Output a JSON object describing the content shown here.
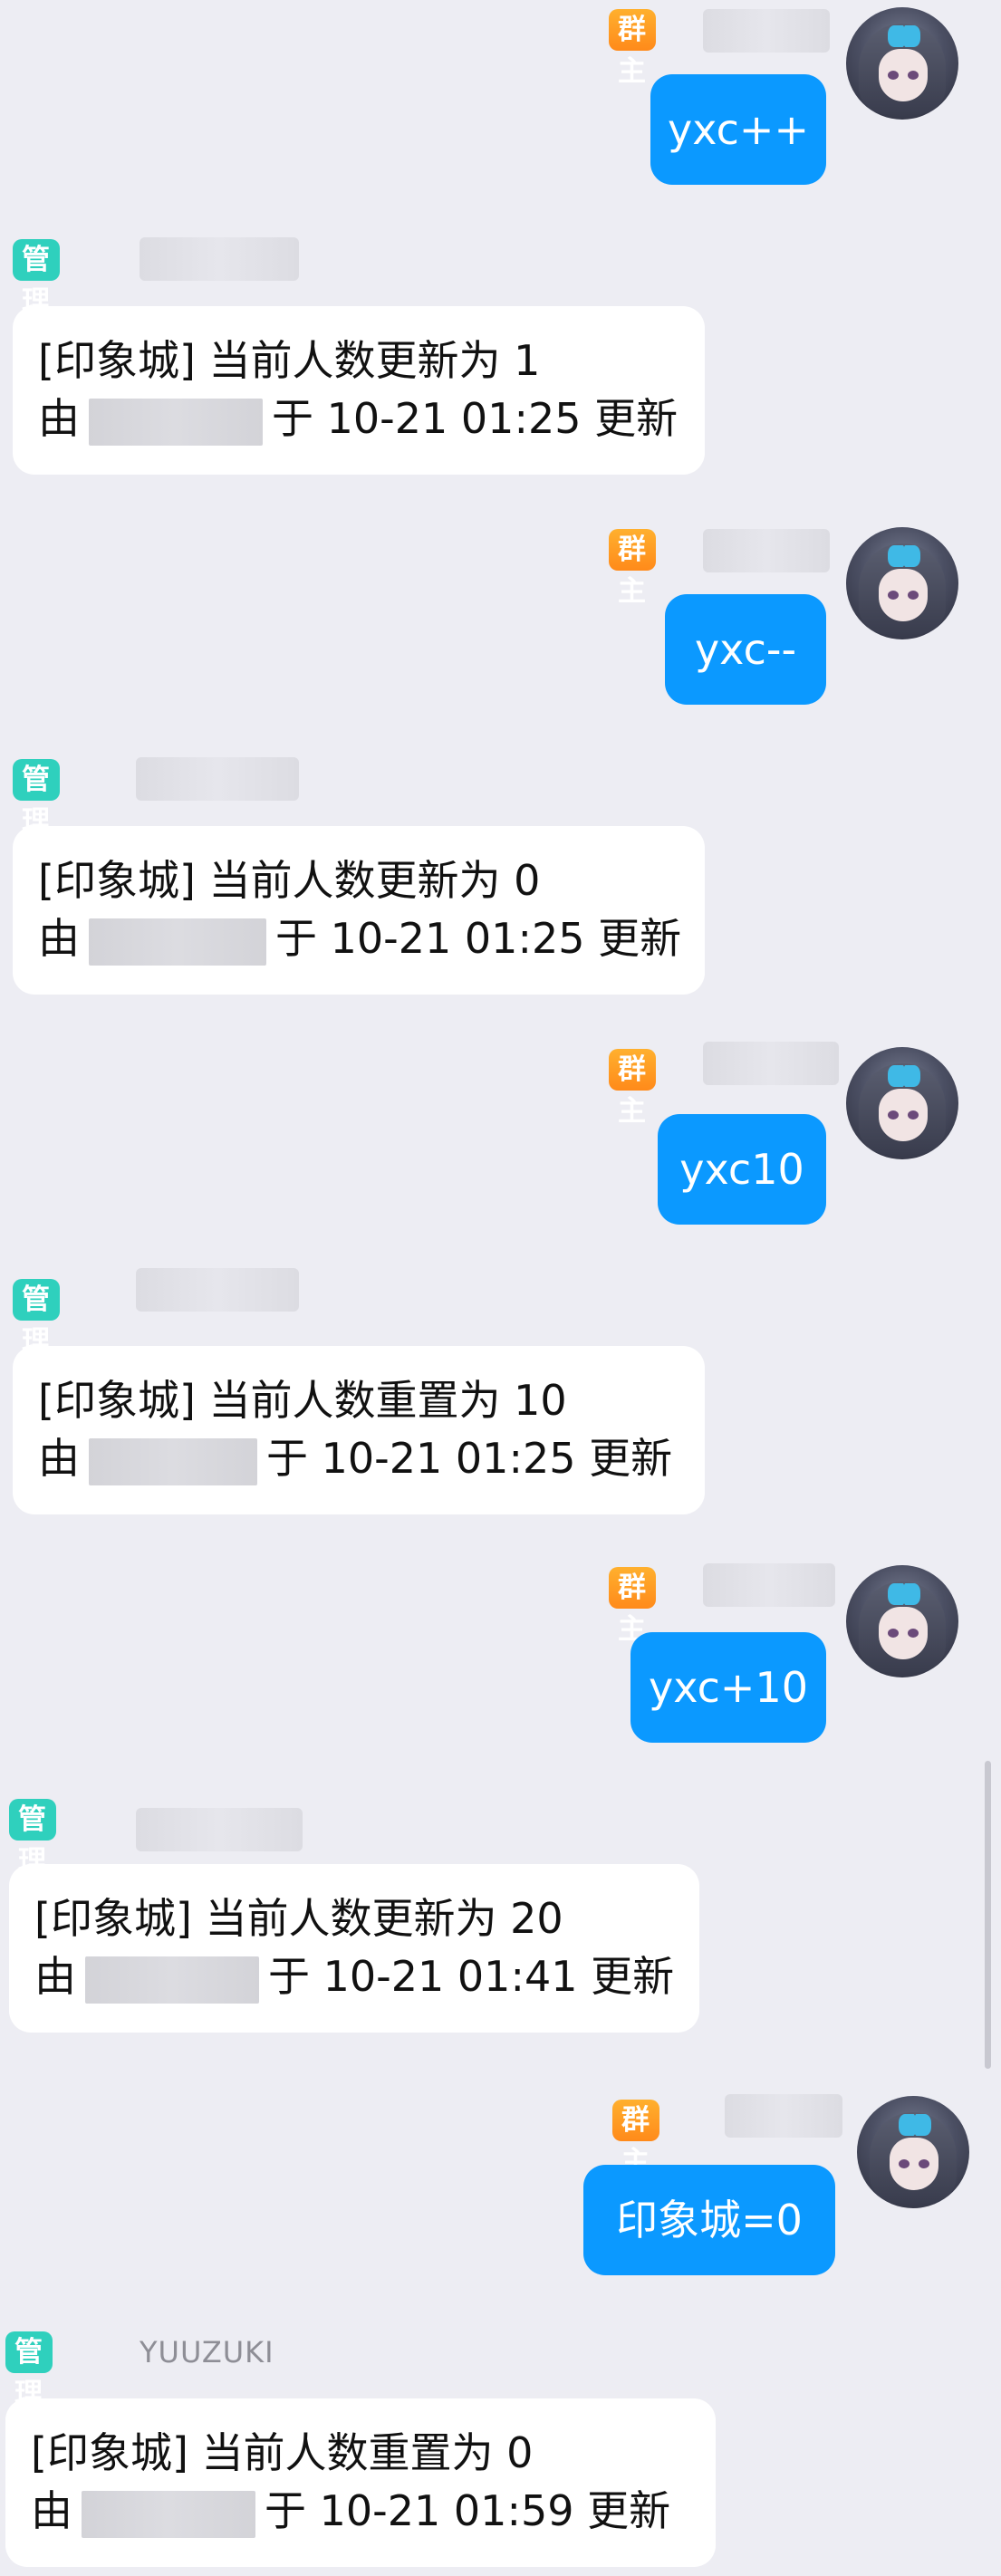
{
  "badges": {
    "owner": "群主",
    "admin": "管理员"
  },
  "conversation": [
    {
      "role": "owner",
      "text": "yxc++"
    },
    {
      "role": "admin",
      "line1": "[印象城] 当前人数更新为 1",
      "prefix": "由",
      "suffix": "于 10-21 01:25 更新"
    },
    {
      "role": "owner",
      "text": "yxc--"
    },
    {
      "role": "admin",
      "line1": "[印象城] 当前人数更新为 0",
      "prefix": "由",
      "suffix": "于 10-21 01:25 更新"
    },
    {
      "role": "owner",
      "text": "yxc10"
    },
    {
      "role": "admin",
      "line1": "[印象城] 当前人数重置为 10",
      "prefix": "由",
      "suffix": "于 10-21 01:25 更新"
    },
    {
      "role": "owner",
      "text": "yxc+10"
    },
    {
      "role": "admin",
      "line1": "[印象城] 当前人数更新为 20",
      "prefix": "由",
      "suffix": "于 10-21 01:41 更新"
    },
    {
      "role": "owner",
      "text": "印象城=0"
    },
    {
      "role": "admin",
      "sender": "YUUZUKI",
      "line1": "[印象城] 当前人数重置为 0",
      "prefix": "由",
      "suffix": "于 10-21 01:59 更新"
    }
  ]
}
